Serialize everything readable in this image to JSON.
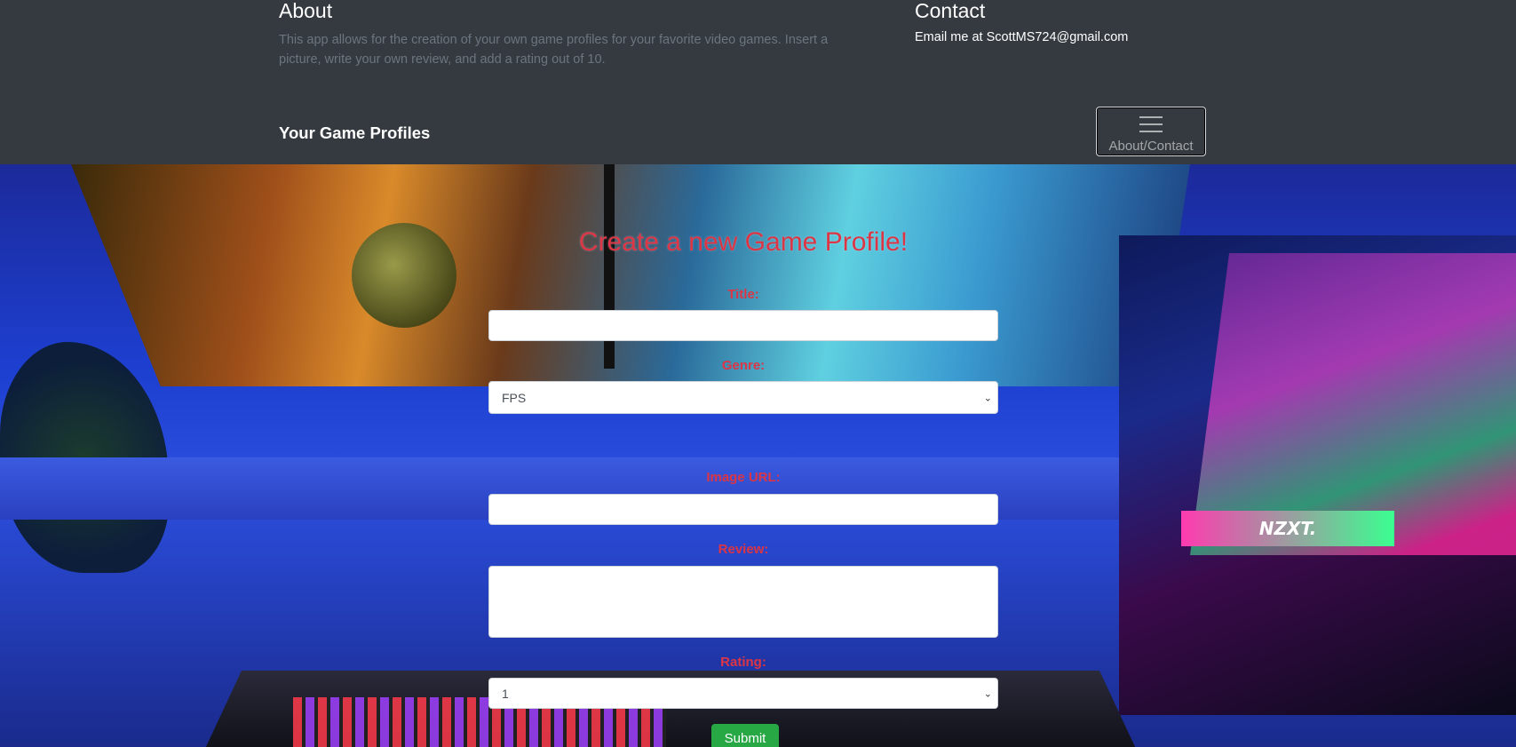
{
  "footer": {
    "about": {
      "heading": "About",
      "text": "This app allows for the creation of your own game profiles for your favorite video games. Insert a picture, write your own review, and add a rating out of 10."
    },
    "contact": {
      "heading": "Contact",
      "text": "Email me at ScottMS724@gmail.com"
    }
  },
  "navbar": {
    "brand": "Your Game Profiles",
    "toggle_label": "About/Contact"
  },
  "form": {
    "heading": "Create a new Game Profile!",
    "title_label": "Title:",
    "title_value": "",
    "genre_label": "Genre:",
    "genre_selected": "FPS",
    "image_label": "Image URL:",
    "image_value": "",
    "review_label": "Review:",
    "review_value": "",
    "rating_label": "Rating:",
    "rating_selected": "1",
    "submit_label": "Submit"
  },
  "colors": {
    "topbar": "#343a40",
    "label_red": "#dc3545",
    "submit_green": "#28a745"
  },
  "icons": {
    "toggle": "hamburger-menu-icon",
    "select_caret": "chevron-down-icon"
  }
}
